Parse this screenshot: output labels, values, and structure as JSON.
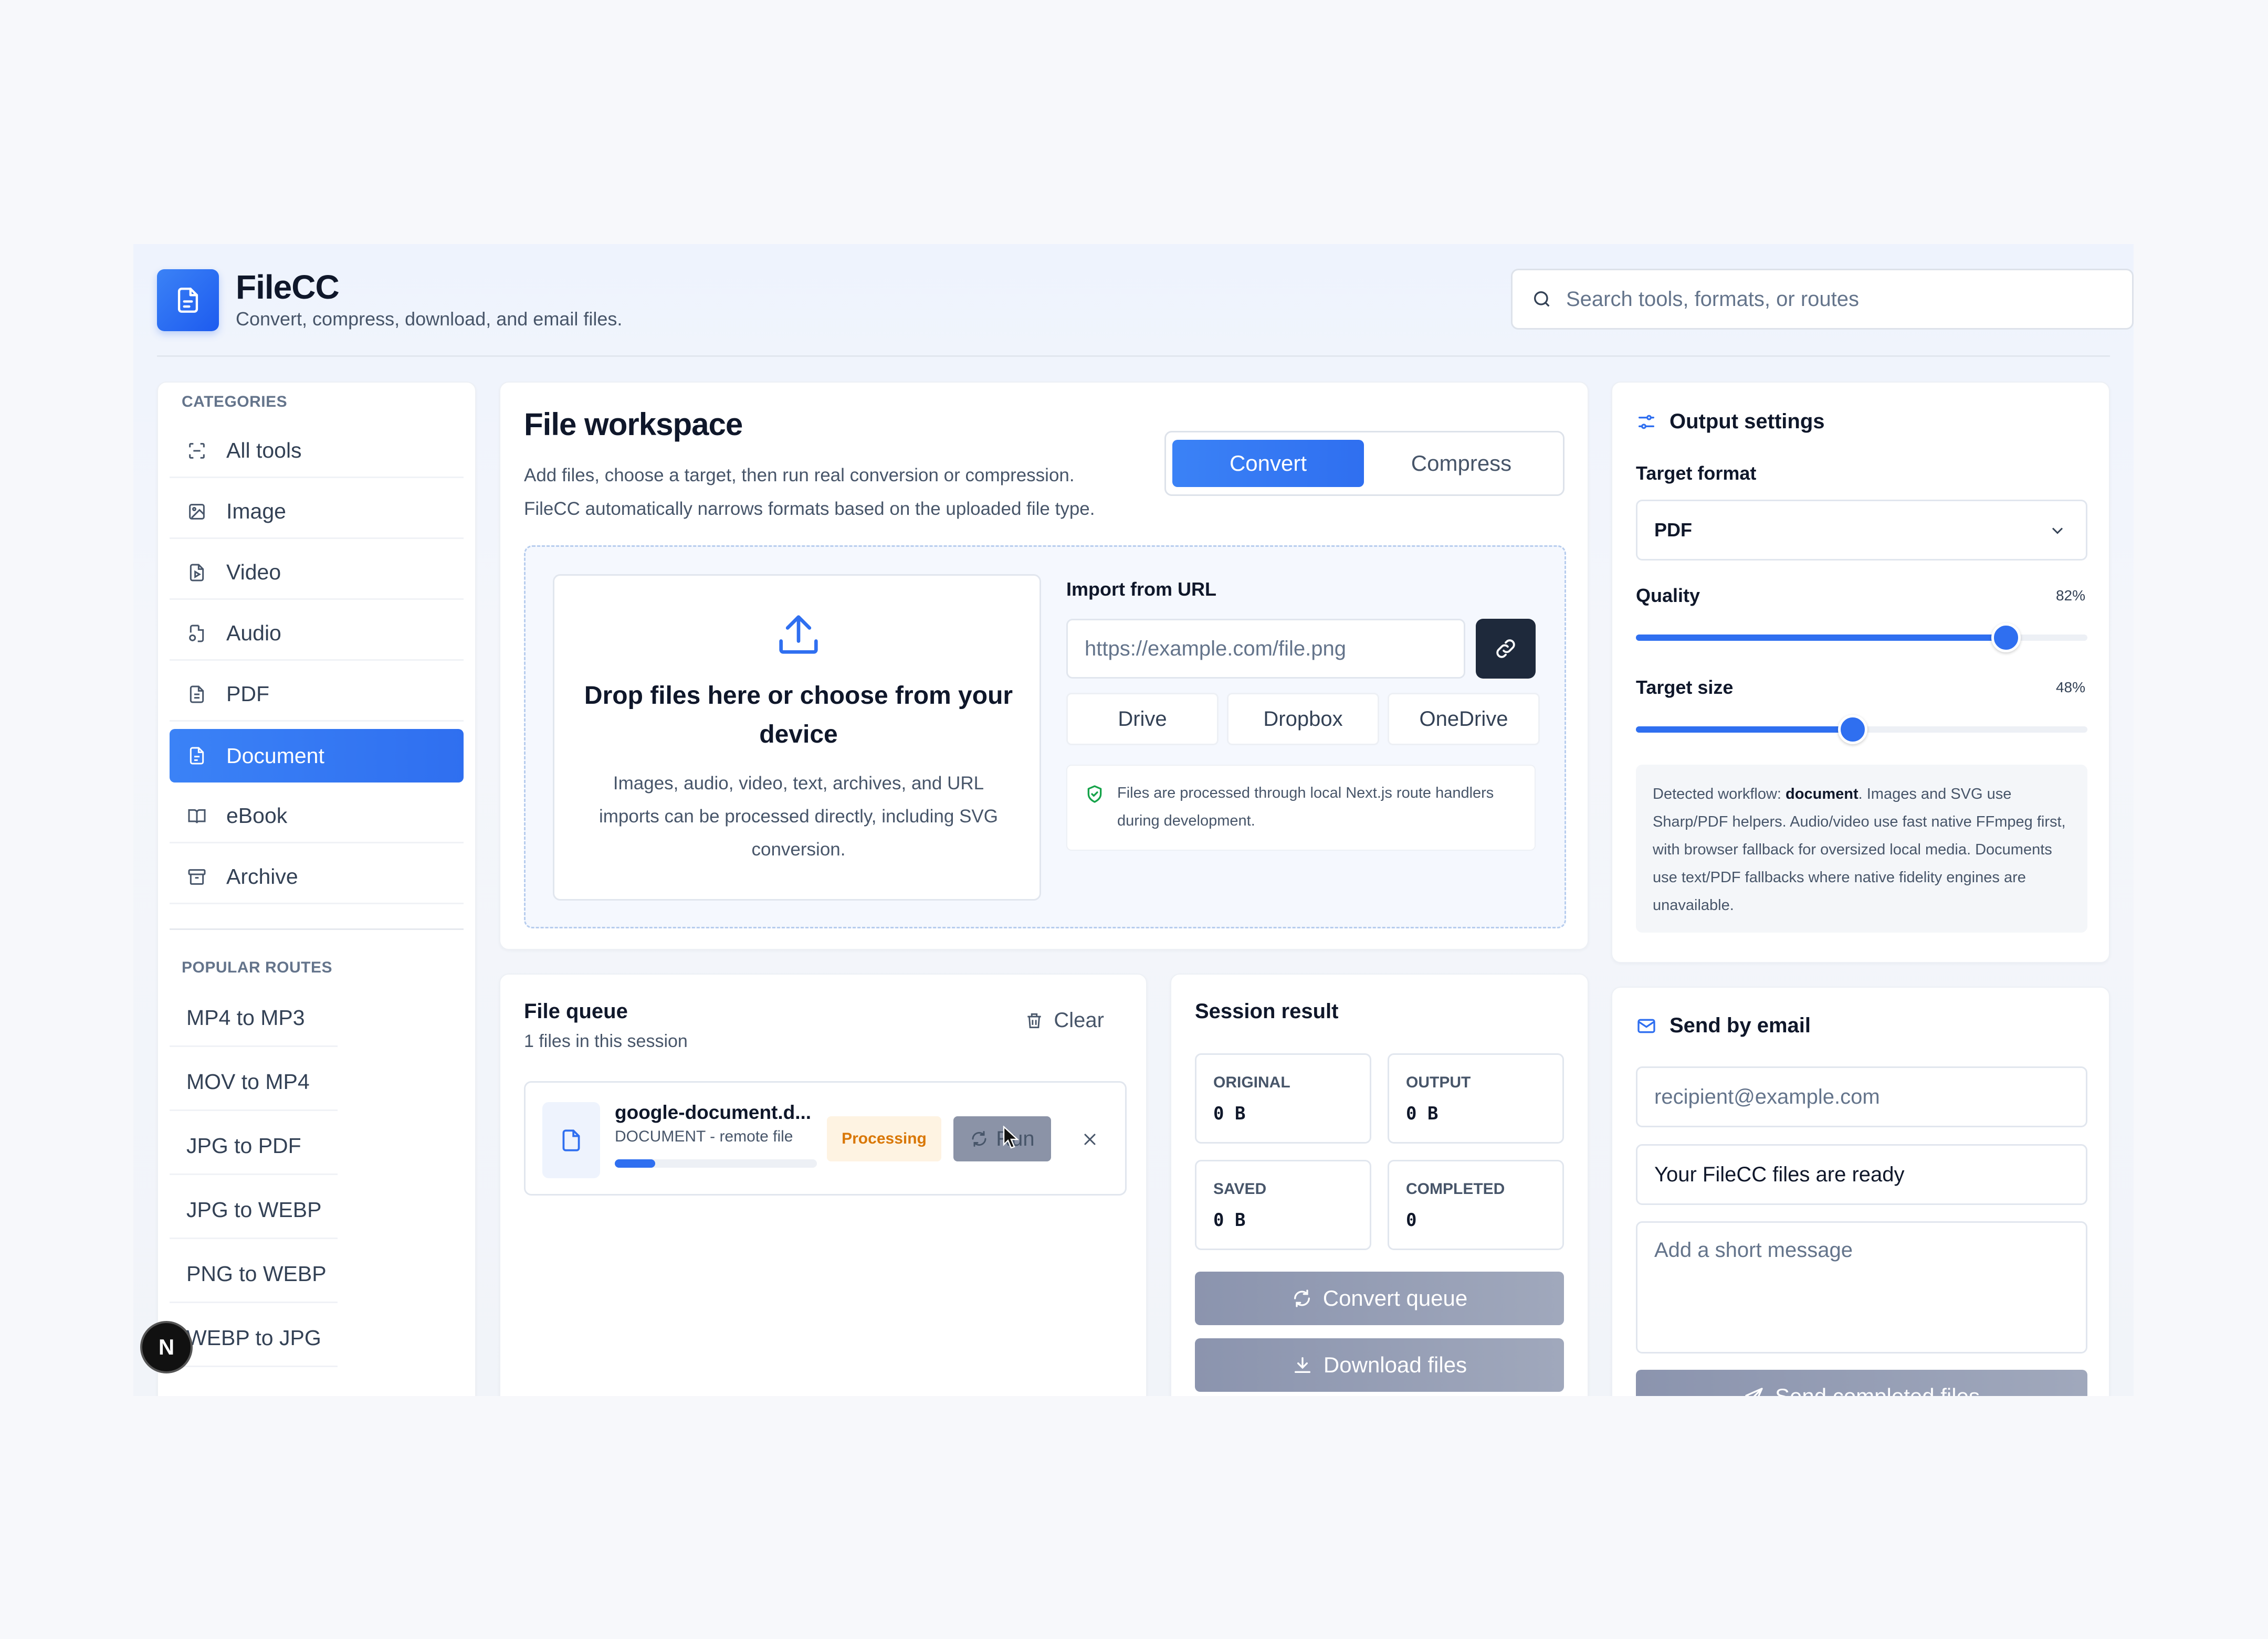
{
  "header": {
    "title": "FileCC",
    "subtitle": "Convert, compress, download, and email files.",
    "search_placeholder": "Search tools, formats, or routes"
  },
  "sidebar": {
    "categories_title": "CATEGORIES",
    "categories": [
      {
        "label": "All tools",
        "icon": "scan-icon"
      },
      {
        "label": "Image",
        "icon": "image-icon"
      },
      {
        "label": "Video",
        "icon": "video-file-icon"
      },
      {
        "label": "Audio",
        "icon": "audio-file-icon"
      },
      {
        "label": "PDF",
        "icon": "pdf-file-icon"
      },
      {
        "label": "Document",
        "icon": "document-icon",
        "active": true
      },
      {
        "label": "eBook",
        "icon": "book-icon"
      },
      {
        "label": "Archive",
        "icon": "archive-icon"
      }
    ],
    "routes_title": "POPULAR ROUTES",
    "routes": [
      "MP4 to MP3",
      "MOV to MP4",
      "JPG to PDF",
      "JPG to WEBP",
      "PNG to WEBP",
      "WEBP to JPG"
    ]
  },
  "workspace": {
    "title": "File workspace",
    "subtitle_line1": "Add files, choose a target, then run real conversion or compression.",
    "subtitle_line2": "FileCC automatically narrows formats based on the uploaded file type.",
    "mode_convert": "Convert",
    "mode_compress": "Compress",
    "drop_title": "Drop files here or choose from your device",
    "drop_desc": "Images, audio, video, text, archives, and URL imports can be processed directly, including SVG conversion.",
    "import_label": "Import from URL",
    "url_placeholder": "https://example.com/file.png",
    "cloud": [
      "Drive",
      "Dropbox",
      "OneDrive"
    ],
    "notice": "Files are processed through local Next.js route handlers during development."
  },
  "settings": {
    "title": "Output settings",
    "target_format_label": "Target format",
    "target_format_value": "PDF",
    "quality_label": "Quality",
    "quality_value": "82%",
    "quality_fraction": 0.82,
    "size_label": "Target size",
    "size_value": "48%",
    "size_fraction": 0.48,
    "workflow_prefix": "Detected workflow: ",
    "workflow_name": "document",
    "workflow_rest": ". Images and SVG use Sharp/PDF helpers. Audio/video use fast native FFmpeg first, with browser fallback for oversized local media. Documents use text/PDF fallbacks where native fidelity engines are unavailable."
  },
  "queue": {
    "title": "File queue",
    "subtitle": "1 files in this session",
    "clear_label": "Clear",
    "file_name": "google-document.d...",
    "file_meta": "DOCUMENT - remote file",
    "progress": 0.2,
    "status": "Processing",
    "run_label": "Run"
  },
  "session": {
    "title": "Session result",
    "stats": [
      {
        "label": "ORIGINAL",
        "value": "0 B"
      },
      {
        "label": "OUTPUT",
        "value": "0 B"
      },
      {
        "label": "SAVED",
        "value": "0 B"
      },
      {
        "label": "COMPLETED",
        "value": "0"
      }
    ],
    "convert_label": "Convert queue",
    "download_label": "Download files"
  },
  "email": {
    "title": "Send by email",
    "recipient_placeholder": "recipient@example.com",
    "subject_value": "Your FileCC files are ready",
    "message_placeholder": "Add a short message",
    "send_label": "Send completed files"
  },
  "dev_badge": "N",
  "colors": {
    "accent": "#2f6ff0",
    "warning": "#d97706"
  }
}
